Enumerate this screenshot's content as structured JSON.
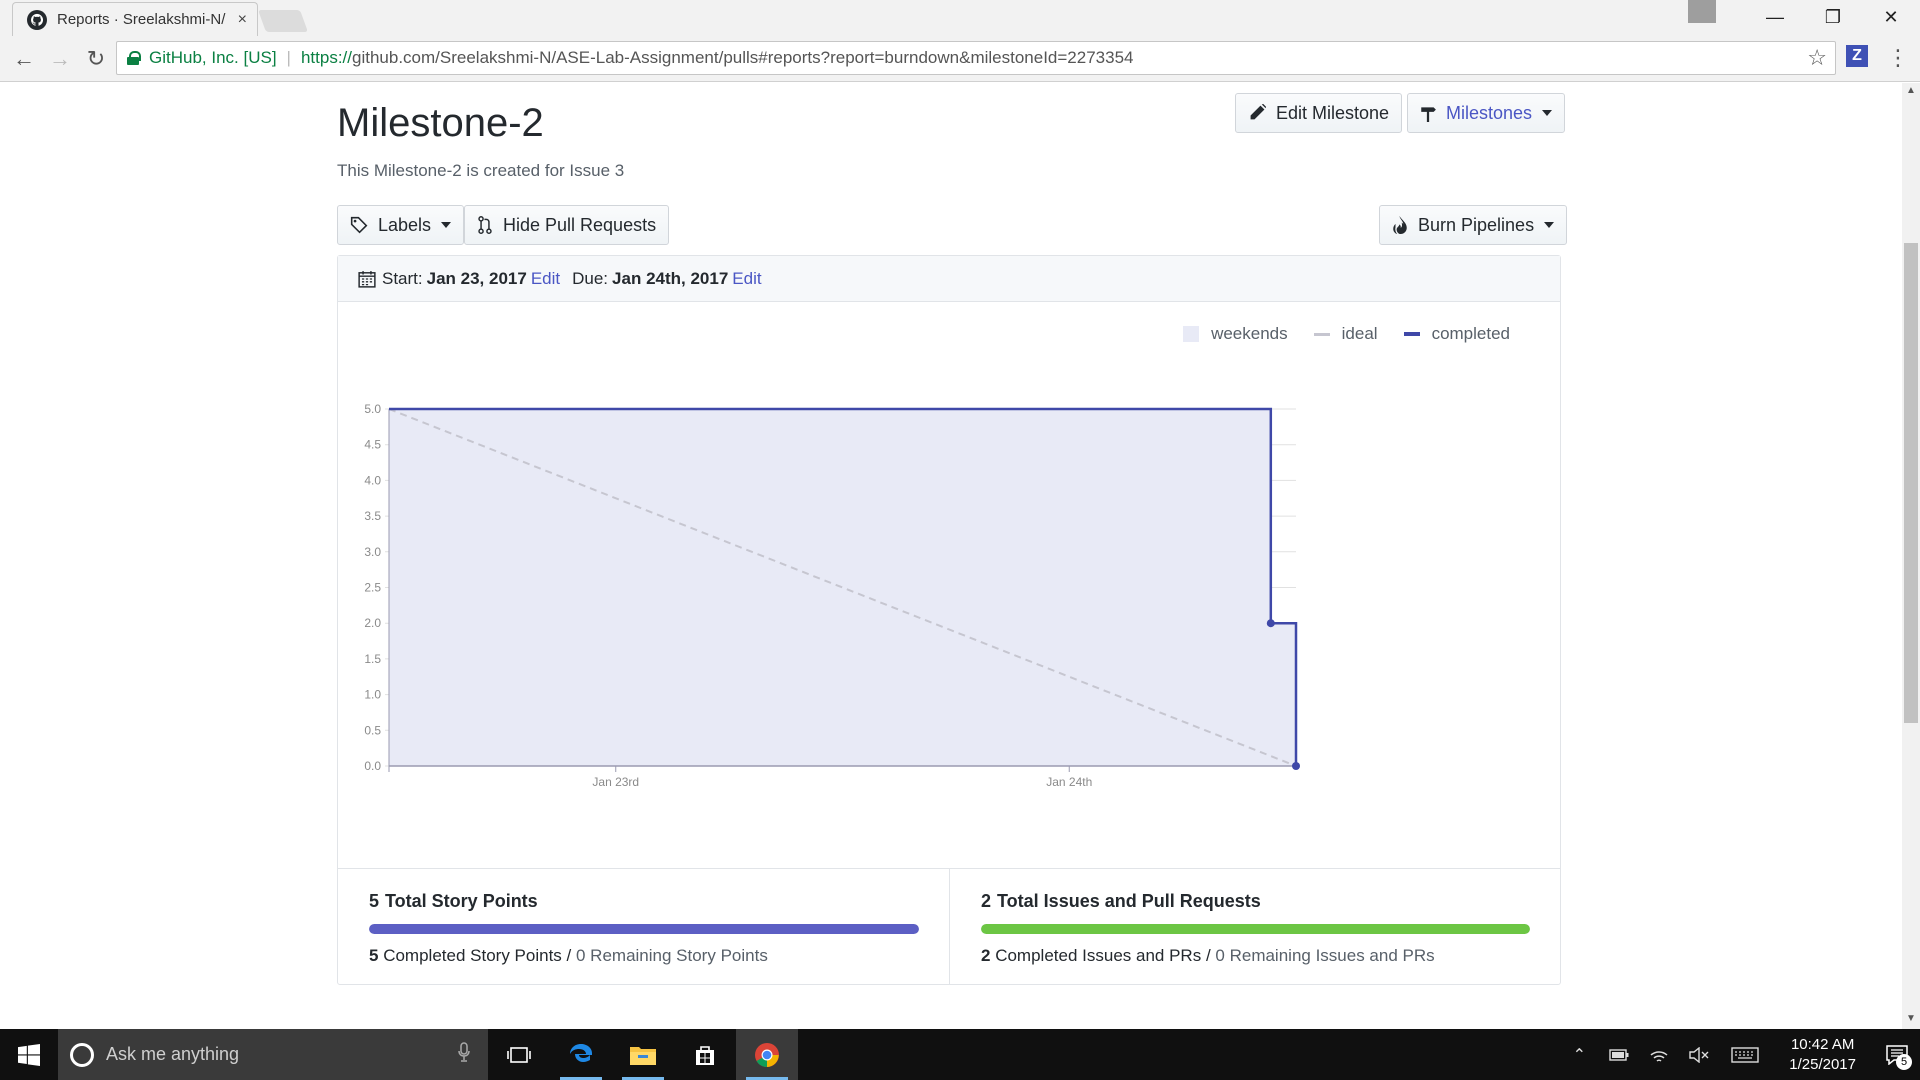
{
  "browser": {
    "tab_title": "Reports · Sreelakshmi-N/",
    "tab_close": "×",
    "org": "GitHub, Inc. [US]",
    "url_scheme": "https://",
    "url_rest": "github.com/Sreelakshmi-N/ASE-Lab-Assignment/pulls#reports?report=burndown&milestoneId=2273354",
    "extension_label": "Z"
  },
  "page": {
    "title": "Milestone-2",
    "description": "This Milestone-2 is created for Issue 3",
    "edit_milestone": "Edit Milestone",
    "milestones": "Milestones",
    "labels": "Labels",
    "hide_pull_requests": "Hide Pull Requests",
    "burn_pipelines": "Burn Pipelines"
  },
  "dates": {
    "start_label": "Start:",
    "start_value": "Jan 23, 2017",
    "due_label": "Due:",
    "due_value": "Jan 24th, 2017",
    "edit": "Edit"
  },
  "legend": {
    "weekends": "weekends",
    "ideal": "ideal",
    "completed": "completed"
  },
  "chart_data": {
    "type": "line",
    "title": "",
    "xlabel": "",
    "ylabel": "",
    "ylim": [
      0,
      5
    ],
    "y_ticks": [
      "0.0",
      "0.5",
      "1.0",
      "1.5",
      "2.0",
      "2.5",
      "3.0",
      "3.5",
      "4.0",
      "4.5",
      "5.0"
    ],
    "x_range": [
      "2017-01-23T00:00",
      "2017-01-25T00:00"
    ],
    "x_ticks": [
      {
        "x": "2017-01-23T12:00",
        "label": "Jan 23rd"
      },
      {
        "x": "2017-01-24T12:00",
        "label": "Jan 24th"
      }
    ],
    "grid": true,
    "legend_position": "top-right",
    "series": [
      {
        "name": "ideal",
        "style": "dashed",
        "color": "#c6c6d0",
        "points": [
          {
            "x": "2017-01-23T00:00",
            "y": 5
          },
          {
            "x": "2017-01-25T00:00",
            "y": 0
          }
        ]
      },
      {
        "name": "completed",
        "style": "step",
        "color": "#3f48a8",
        "points": [
          {
            "x": "2017-01-23T00:00",
            "y": 5
          },
          {
            "x": "2017-01-24T22:40",
            "y": 5
          },
          {
            "x": "2017-01-24T22:40",
            "y": 2
          },
          {
            "x": "2017-01-25T00:00",
            "y": 2
          },
          {
            "x": "2017-01-25T00:00",
            "y": 0
          }
        ],
        "markers": [
          {
            "x": "2017-01-24T22:40",
            "y": 2
          },
          {
            "x": "2017-01-25T00:00",
            "y": 0
          }
        ]
      }
    ]
  },
  "stats": {
    "points_total": "5",
    "points_total_label": "Total Story Points",
    "points_completed": "5",
    "points_completed_label": "Completed Story Points",
    "points_remaining": "0 Remaining Story Points",
    "points_progress": 1.0,
    "points_color": "#5c5fc4",
    "issues_total": "2",
    "issues_total_label": "Total Issues and Pull Requests",
    "issues_completed": "2",
    "issues_completed_label": "Completed Issues and PRs",
    "issues_remaining": "0 Remaining Issues and PRs",
    "issues_progress": 1.0,
    "issues_color": "#6cc644",
    "divider": "/"
  },
  "taskbar": {
    "search_placeholder": "Ask me anything",
    "time": "10:42 AM",
    "date": "1/25/2017",
    "notifications": "5"
  },
  "colors": {
    "accent": "#4a56c4",
    "completed_line": "#3f48a8",
    "chart_fill": "#e8eaf6"
  }
}
